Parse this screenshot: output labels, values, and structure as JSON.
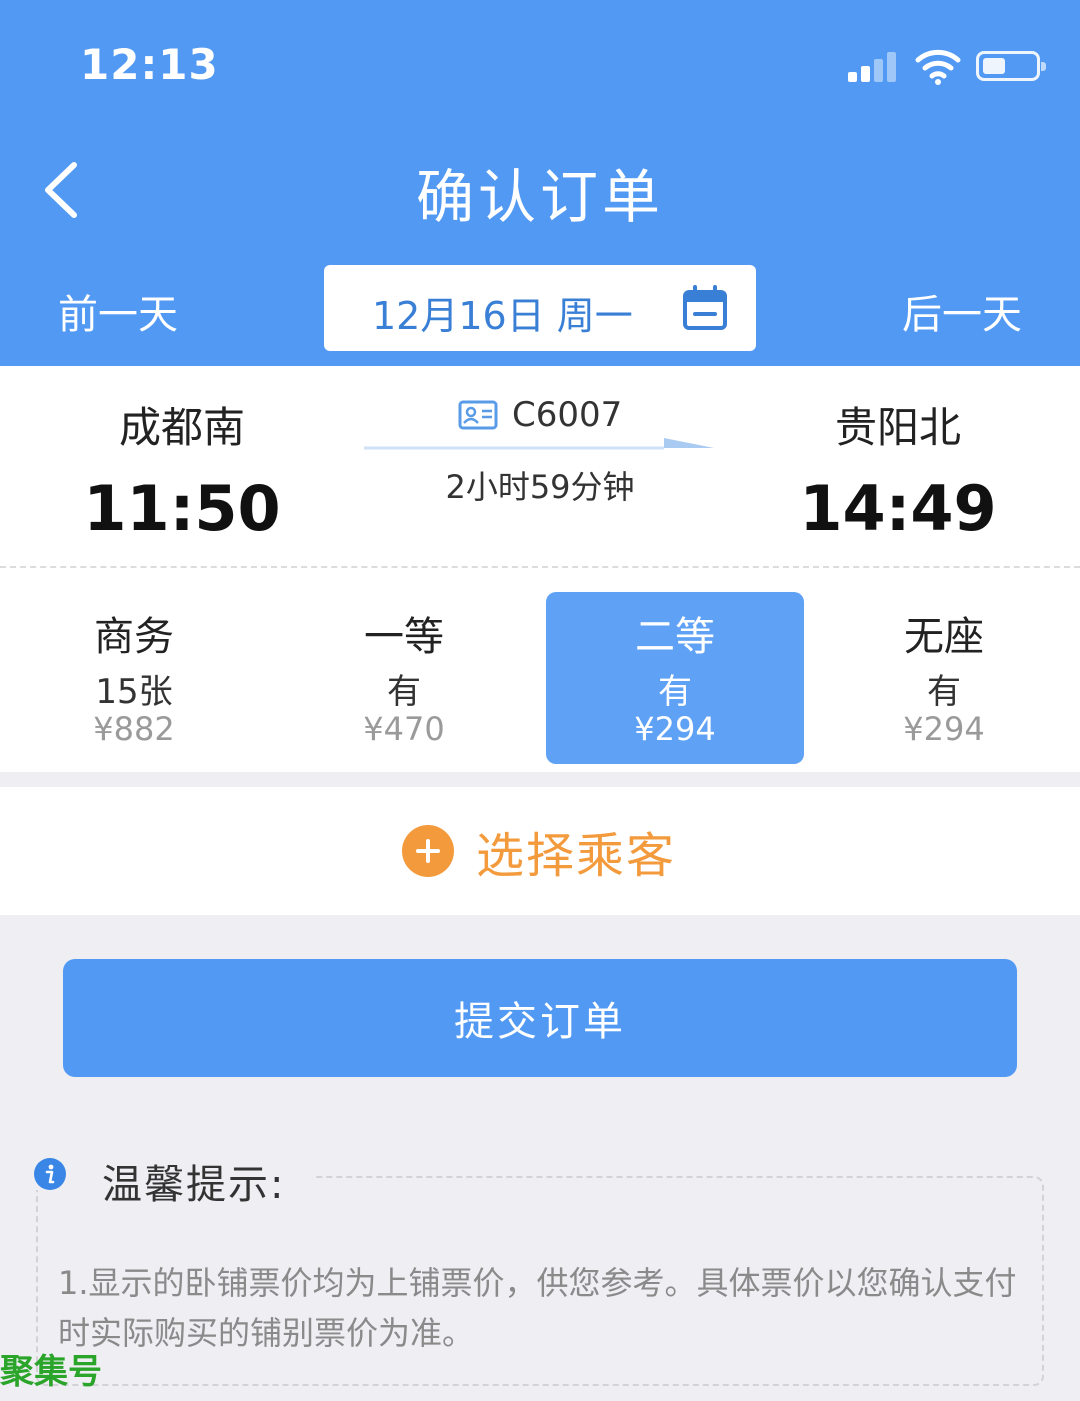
{
  "status_bar": {
    "time": "12:13"
  },
  "nav": {
    "title": "确认订单",
    "prev_day": "前一天",
    "next_day": "后一天",
    "date": "12月16日 周一"
  },
  "train": {
    "number": "C6007",
    "from_station": "成都南",
    "from_time": "11:50",
    "to_station": "贵阳北",
    "to_time": "14:49",
    "duration": "2小时59分钟"
  },
  "seats": [
    {
      "class": "商务",
      "availability": "15张",
      "price": "¥882",
      "selected": false
    },
    {
      "class": "一等",
      "availability": "有",
      "price": "¥470",
      "selected": false
    },
    {
      "class": "二等",
      "availability": "有",
      "price": "¥294",
      "selected": true
    },
    {
      "class": "无座",
      "availability": "有",
      "price": "¥294",
      "selected": false
    }
  ],
  "passenger": {
    "add_label": "选择乘客"
  },
  "submit": {
    "label": "提交订单"
  },
  "tips": {
    "title": "温馨提示:",
    "text": "1.显示的卧铺票价均为上铺票价，供您参考。具体票价以您确认支付时实际购买的铺别票价为准。"
  },
  "watermark": "聚集号",
  "colors": {
    "primary": "#5199f3",
    "selected_seat": "#5ea1f5",
    "accent_orange": "#f39a3c",
    "background": "#eeeef3"
  }
}
